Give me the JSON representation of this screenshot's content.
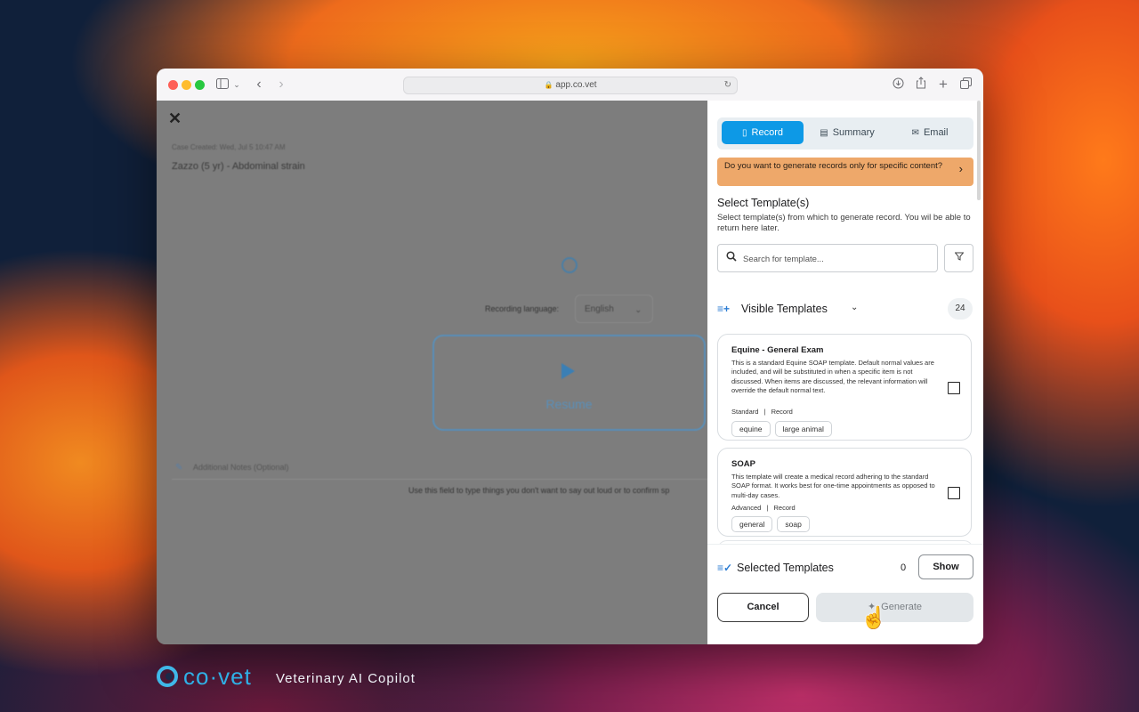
{
  "browser": {
    "url": "app.co.vet"
  },
  "page": {
    "case_created": "Case Created: Wed, Jul 5 10:47 AM",
    "case_title": "Zazzo (5 yr) - Abdominal strain",
    "recording_language_label": "Recording language:",
    "recording_language_value": "English",
    "resume_label": "Resume",
    "additional_notes_label": "Additional Notes (Optional)",
    "additional_notes_help": "Use this field to type things you don't want to say out loud or to confirm sp"
  },
  "panel": {
    "tabs": [
      {
        "label": "Record",
        "active": true
      },
      {
        "label": "Summary",
        "active": false
      },
      {
        "label": "Email",
        "active": false
      }
    ],
    "banner": "Do you want to generate records only for specific content?",
    "select_title": "Select Template(s)",
    "select_desc": "Select template(s) from which to generate record. You wil be able to return here later.",
    "search_placeholder": "Search for template...",
    "visible_templates_label": "Visible Templates",
    "visible_templates_count": "24",
    "templates": [
      {
        "name": "Equine - General Exam",
        "description": "This is a standard Equine SOAP template. Default normal values are included, and will be substituted in when a specific item is not discussed. When items are discussed, the relevant information will override the default normal text.",
        "level": "Standard",
        "kind": "Record",
        "tags": [
          "equine",
          "large animal"
        ],
        "checked": false
      },
      {
        "name": "SOAP",
        "description": "This template will create a medical record adhering to the standard SOAP format. It works best for one-time appointments as opposed to multi-day cases.",
        "level": "Advanced",
        "kind": "Record",
        "tags": [
          "general",
          "soap"
        ],
        "checked": false
      }
    ],
    "selected_templates_label": "Selected Templates",
    "selected_templates_count": "0",
    "show_label": "Show",
    "cancel_label": "Cancel",
    "generate_label": "Generate"
  },
  "branding": {
    "logo": "co·vet",
    "tagline": "Veterinary AI Copilot"
  },
  "colors": {
    "accent": "#0d99e6",
    "banner": "#eea86a",
    "brand": "#2fb0e6"
  },
  "icons": [
    "sidebar-icon",
    "chevron-left-icon",
    "chevron-right-icon",
    "lock-icon",
    "reload-icon",
    "download-icon",
    "share-icon",
    "new-tab-icon",
    "tabs-icon",
    "close-icon",
    "mic-icon",
    "play-icon",
    "document-icon",
    "summary-icon",
    "mail-icon",
    "search-icon",
    "filter-icon",
    "playlist-add-icon",
    "chevron-down-icon",
    "playlist-check-icon",
    "sparkle-icon",
    "hand-cursor-icon"
  ]
}
